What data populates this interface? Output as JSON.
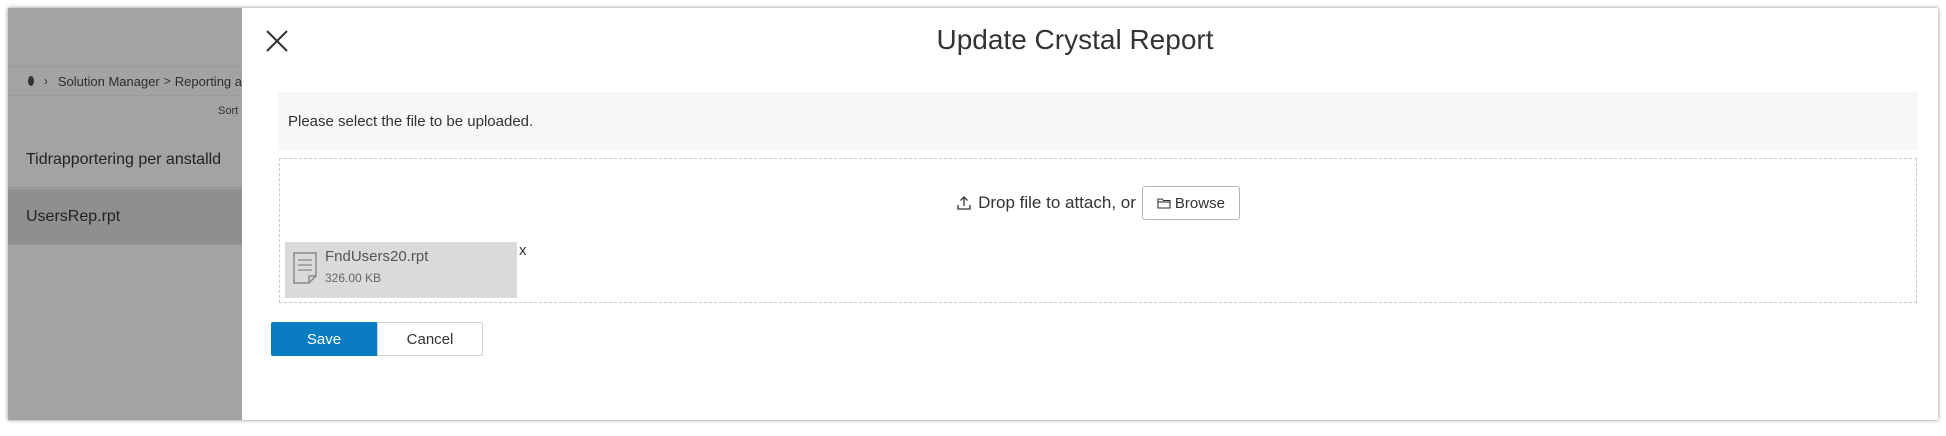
{
  "background": {
    "breadcrumb": {
      "items": [
        "Solution Manager",
        "Reporting a"
      ]
    },
    "sort_label": "Sort",
    "list": [
      {
        "label": "Tidrapportering per anstalld"
      },
      {
        "label": "UsersRep.rpt"
      }
    ]
  },
  "dialog": {
    "title": "Update Crystal Report",
    "info_text": "Please select the file to be uploaded.",
    "dropzone": {
      "prompt": "Drop file to attach, or",
      "browse_label": "Browse"
    },
    "file": {
      "name": "FndUsers20.rpt",
      "size": "326.00 KB",
      "remove_label": "x"
    },
    "actions": {
      "save_label": "Save",
      "cancel_label": "Cancel"
    }
  },
  "colors": {
    "primary": "#0a7dc2",
    "overlay": "#a3a3a3",
    "file_card": "#dadada"
  },
  "icons": [
    "close-icon",
    "upload-icon",
    "folder-icon",
    "document-icon",
    "chevron-right-icon"
  ]
}
